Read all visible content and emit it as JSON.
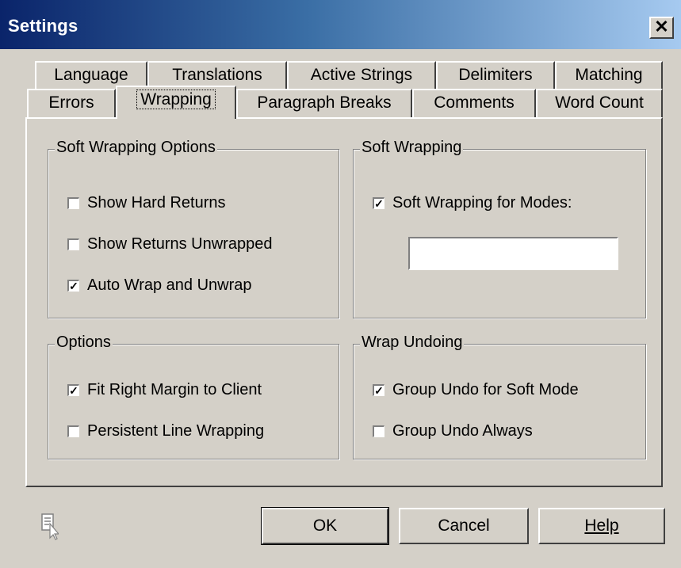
{
  "window": {
    "title": "Settings",
    "close_glyph": "✕"
  },
  "tabs_row1": [
    "Language",
    "Translations",
    "Active Strings",
    "Delimiters",
    "Matching"
  ],
  "tabs_row2": [
    "Errors",
    "Wrapping",
    "Paragraph Breaks",
    "Comments",
    "Word Count"
  ],
  "active_tab": "Wrapping",
  "groups": {
    "soft_wrapping_options": {
      "label": "Soft Wrapping Options",
      "items": [
        {
          "label": "Show Hard Returns",
          "checked": false
        },
        {
          "label": "Show Returns Unwrapped",
          "checked": false
        },
        {
          "label": "Auto Wrap and Unwrap",
          "checked": true
        }
      ]
    },
    "soft_wrapping": {
      "label": "Soft Wrapping",
      "checkbox": {
        "label": "Soft Wrapping for Modes:",
        "checked": true
      },
      "modes_value": ""
    },
    "options": {
      "label": "Options",
      "items": [
        {
          "label": "Fit Right Margin to Client",
          "checked": true
        },
        {
          "label": "Persistent Line Wrapping",
          "checked": false
        }
      ]
    },
    "wrap_undoing": {
      "label": "Wrap Undoing",
      "items": [
        {
          "label": "Group Undo for Soft Mode",
          "checked": true
        },
        {
          "label": "Group Undo Always",
          "checked": false
        }
      ]
    }
  },
  "buttons": {
    "ok": "OK",
    "cancel": "Cancel",
    "help": "Help"
  },
  "icons": {
    "context_help": "context-help-icon"
  },
  "colors": {
    "title_gradient_start": "#0a246a",
    "title_gradient_end": "#a6caf0",
    "face": "#d4d0c8"
  }
}
